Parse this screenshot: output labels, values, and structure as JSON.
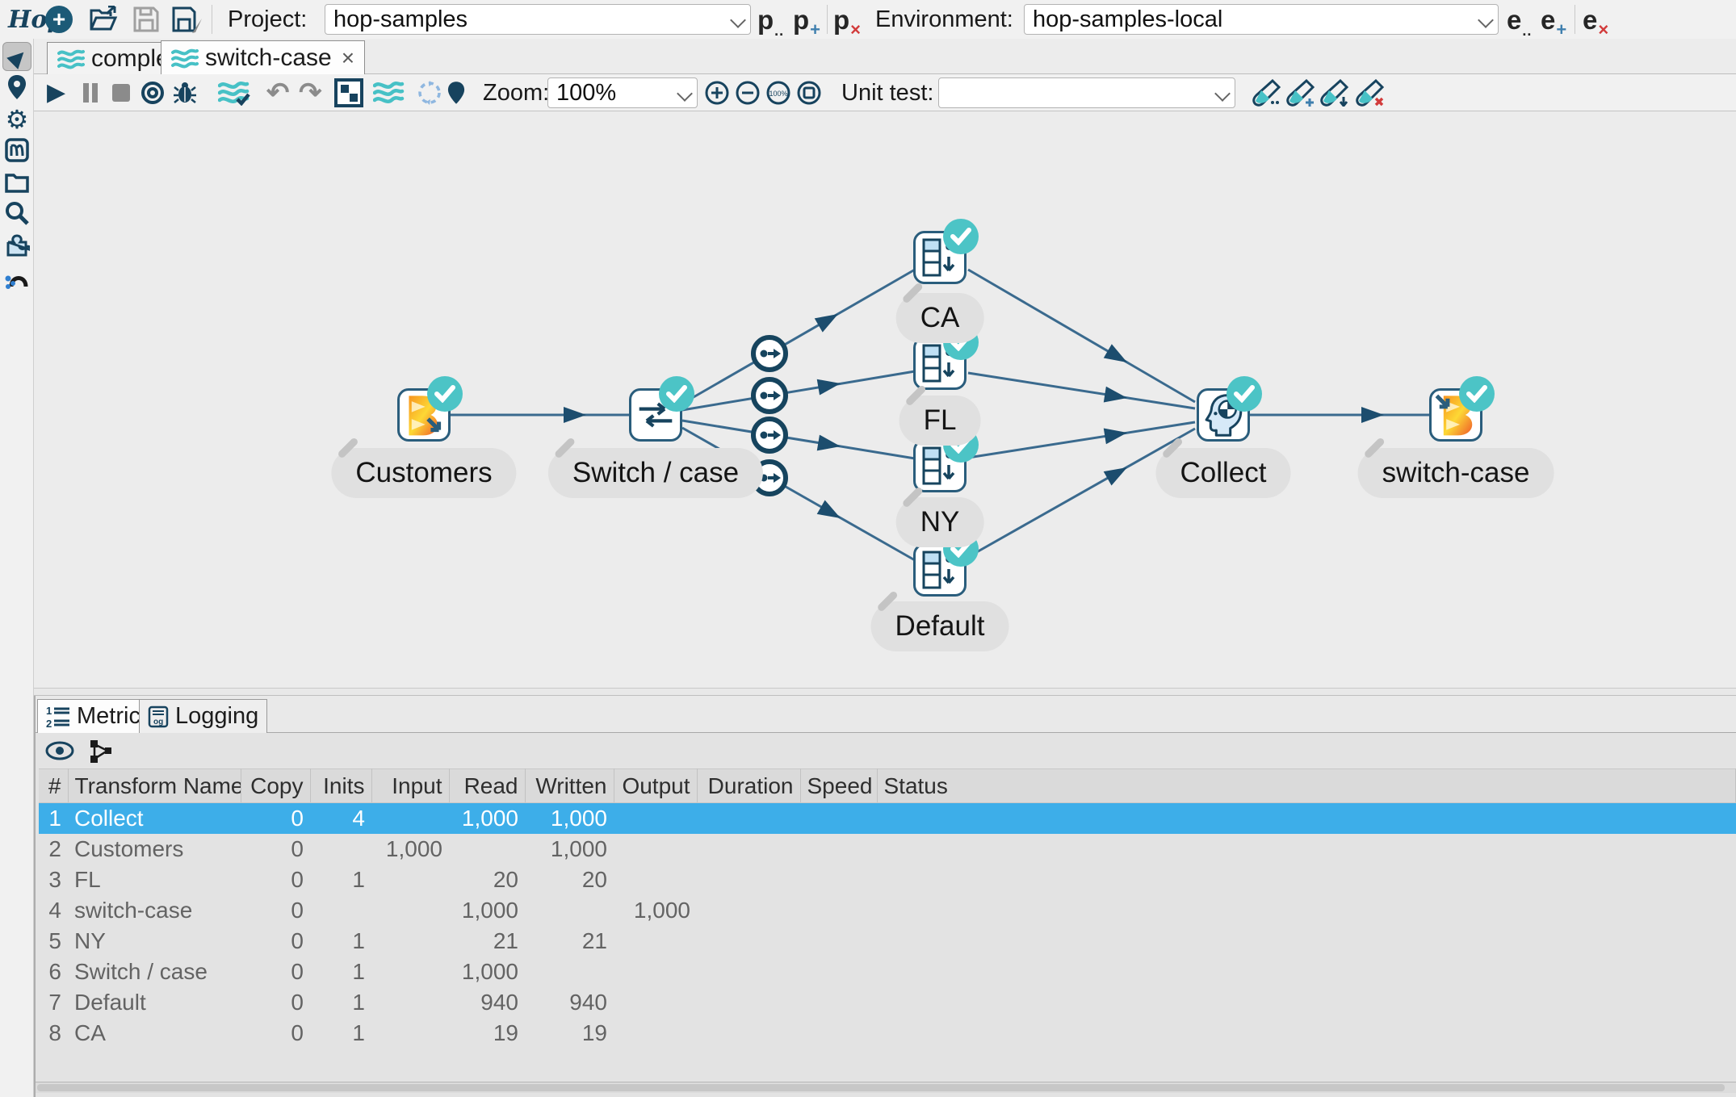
{
  "top_toolbar": {
    "project_label": "Project:",
    "project_value": "hop-samples",
    "environment_label": "Environment:",
    "environment_value": "hop-samples-local",
    "icons": [
      "hop-logo",
      "new",
      "open",
      "save",
      "save-as",
      "project-edit",
      "project-add",
      "project-delete",
      "environment-edit",
      "environment-add",
      "environment-delete"
    ]
  },
  "file_tabs": [
    {
      "label": "complex",
      "active": false
    },
    {
      "label": "switch-case",
      "active": true,
      "close_glyph": "×"
    }
  ],
  "left_rail_icons": [
    "pointer-tool",
    "location-pin",
    "settings-gear",
    "metadata",
    "folder-explorer",
    "search",
    "plugins-puzzle",
    "neo4j-perspective"
  ],
  "pipeline_toolbar": {
    "zoom_label": "Zoom:",
    "zoom_value": "100%",
    "unit_test_label": "Unit test:",
    "unit_test_value": "",
    "icons": [
      "run",
      "pause",
      "stop",
      "preview",
      "debug",
      "check-pipeline",
      "undo",
      "redo",
      "show-results",
      "pipeline",
      "refresh",
      "pin",
      "zoom-in",
      "zoom-out",
      "zoom-100",
      "zoom-fit",
      "test-edit",
      "test-add",
      "test-detach",
      "test-delete"
    ]
  },
  "canvas": {
    "nodes": [
      {
        "label": "Customers",
        "type": "beam-input"
      },
      {
        "label": "Switch / case",
        "type": "switch-case"
      },
      {
        "label": "CA",
        "type": "add-constants"
      },
      {
        "label": "FL",
        "type": "add-constants"
      },
      {
        "label": "NY",
        "type": "add-constants"
      },
      {
        "label": "Default",
        "type": "add-constants"
      },
      {
        "label": "Collect",
        "type": "memory-group-by"
      },
      {
        "label": "switch-case",
        "type": "beam-output"
      }
    ],
    "all_nodes_status": "success-check"
  },
  "bottom_panel": {
    "tabs": [
      {
        "label": "Metrics",
        "active": true
      },
      {
        "label": "Logging",
        "active": false
      }
    ],
    "table": {
      "headers": [
        "#",
        "Transform Name",
        "Copy",
        "Inits",
        "Input",
        "Read",
        "Written",
        "Output",
        "Duration",
        "Speed",
        "Status"
      ],
      "selected_row": 0,
      "rows": [
        [
          "1",
          "Collect",
          "0",
          "4",
          "",
          "1,000",
          "1,000",
          "",
          "",
          "",
          ""
        ],
        [
          "2",
          "Customers",
          "0",
          "",
          "1,000",
          "",
          "1,000",
          "",
          "",
          "",
          ""
        ],
        [
          "3",
          "FL",
          "0",
          "1",
          "",
          "20",
          "20",
          "",
          "",
          "",
          ""
        ],
        [
          "4",
          "switch-case",
          "0",
          "",
          "",
          "1,000",
          "",
          "1,000",
          "",
          "",
          ""
        ],
        [
          "5",
          "NY",
          "0",
          "1",
          "",
          "21",
          "21",
          "",
          "",
          "",
          ""
        ],
        [
          "6",
          "Switch / case",
          "0",
          "1",
          "",
          "1,000",
          "",
          "",
          "",
          "",
          ""
        ],
        [
          "7",
          "Default",
          "0",
          "1",
          "",
          "940",
          "940",
          "",
          "",
          "",
          ""
        ],
        [
          "8",
          "CA",
          "0",
          "1",
          "",
          "19",
          "19",
          "",
          "",
          "",
          ""
        ]
      ]
    }
  },
  "colors": {
    "selection_blue": "#3daee9",
    "hop_navy": "#17435e",
    "hop_line": "#3a6a8e",
    "teal": "#47c1c6",
    "beam_orange_1": "#e85d2a",
    "beam_orange_2": "#fbc02d"
  }
}
